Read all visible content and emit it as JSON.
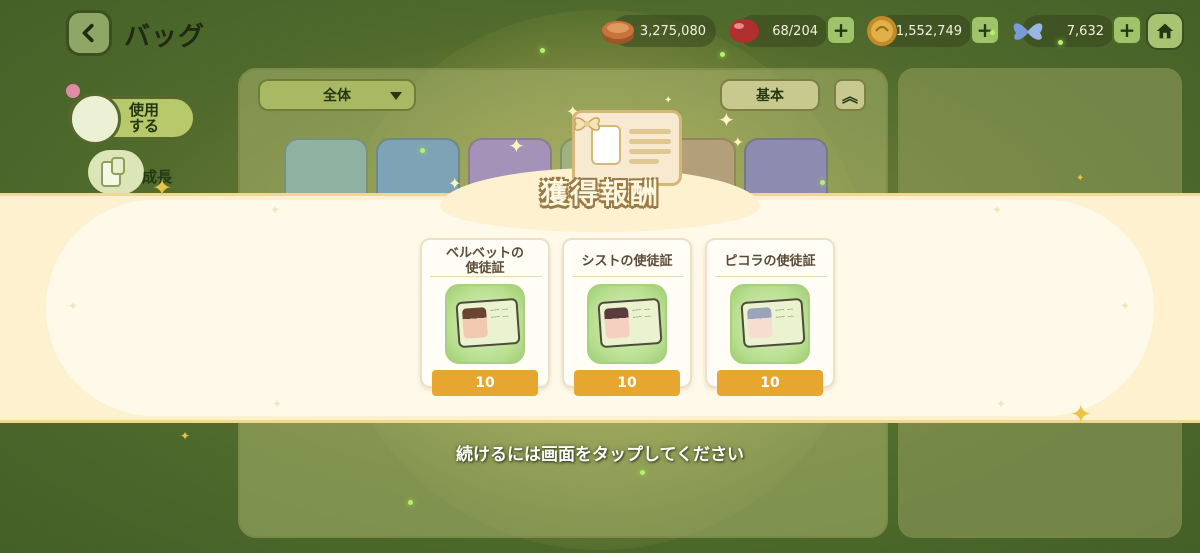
{
  "header": {
    "title": "バッグ",
    "resources": [
      {
        "name": "coin-stack",
        "value": "3,275,080",
        "color": "#c8733a"
      },
      {
        "name": "red-gem",
        "value": "68/204",
        "color": "#c23a3a"
      },
      {
        "name": "gold-coin",
        "value": "1,552,749",
        "color": "#d9a23b"
      },
      {
        "name": "butterfly",
        "value": "7,632",
        "color": "#7a9ad8"
      }
    ]
  },
  "sidebar": {
    "items": [
      {
        "label": "使用\nする",
        "icon": "chest-icon"
      },
      {
        "label": "成長",
        "icon": "scroll-icon"
      }
    ]
  },
  "toolbar": {
    "filter_value": "全体",
    "sort_value": "基本"
  },
  "reward": {
    "title": "獲得報酬",
    "items": [
      {
        "name": "ベルベットの\n使徒証",
        "count": "10"
      },
      {
        "name": "シストの使徒証",
        "count": "10"
      },
      {
        "name": "ピコラの使徒証",
        "count": "10"
      }
    ],
    "tap_hint": "続けるには画面をタップしてください"
  },
  "colors": {
    "accent_orange": "#e6a630",
    "band_cream": "#fdf1cf",
    "bg_green": "#4f6a2c"
  }
}
